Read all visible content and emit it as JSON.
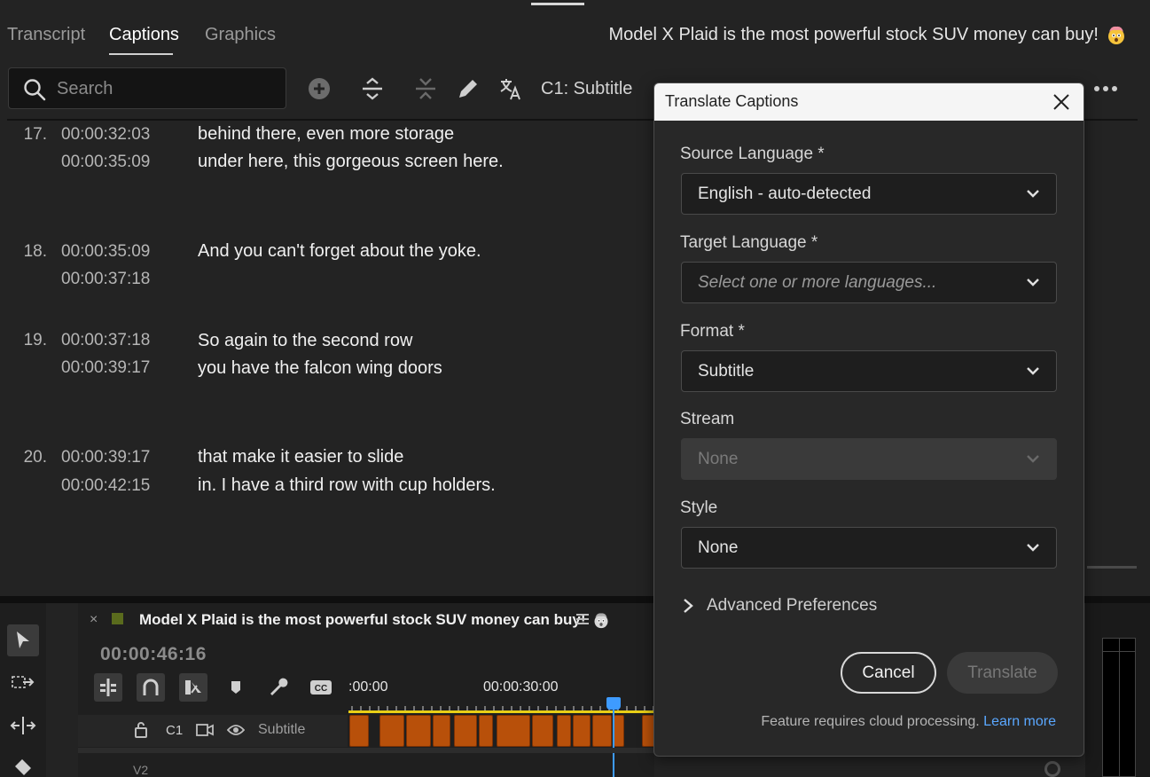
{
  "tabs": [
    {
      "label": "Transcript",
      "active": false
    },
    {
      "label": "Captions",
      "active": true
    },
    {
      "label": "Graphics",
      "active": false
    }
  ],
  "sequence_title": "Model X Plaid is the most powerful stock SUV money can buy!",
  "toolbar": {
    "search_placeholder": "Search",
    "track_label": "C1: Subtitle",
    "icons": [
      "search-icon",
      "add-caption-icon",
      "expand-icon",
      "collapse-icon",
      "pencil-icon",
      "translate-icon",
      "more-icon"
    ]
  },
  "captions": [
    {
      "num": "17.",
      "start": "00:00:32:03",
      "end": "00:00:35:09",
      "line1": "behind there, even more storage",
      "line2": "under here, this gorgeous screen here."
    },
    {
      "num": "18.",
      "start": "00:00:35:09",
      "end": "00:00:37:18",
      "line1": "And you can't forget about the yoke.",
      "line2": ""
    },
    {
      "num": "19.",
      "start": "00:00:37:18",
      "end": "00:00:39:17",
      "line1": "So again to the second row",
      "line2": "you have the falcon wing doors"
    },
    {
      "num": "20.",
      "start": "00:00:39:17",
      "end": "00:00:42:15",
      "line1": "that make it easier to slide",
      "line2": "in. I have a third row with cup holders."
    }
  ],
  "dialog": {
    "title": "Translate Captions",
    "source_label": "Source Language *",
    "source_value": "English - auto-detected",
    "target_label": "Target Language *",
    "target_placeholder": "Select one or more languages...",
    "format_label": "Format *",
    "format_value": "Subtitle",
    "stream_label": "Stream",
    "stream_value": "None",
    "style_label": "Style",
    "style_value": "None",
    "advanced_label": "Advanced Preferences",
    "cancel_label": "Cancel",
    "translate_label": "Translate",
    "footer_text": "Feature requires cloud processing.",
    "footer_link": "Learn more"
  },
  "timeline": {
    "close": "×",
    "title": "Model X Plaid is the most powerful stock SUV money can buy!",
    "timecode": "00:00:46:16",
    "ruler": [
      ":00:00",
      "00:00:30:00"
    ],
    "track": {
      "name": "C1",
      "label": "Subtitle"
    },
    "next_track": "V2"
  },
  "colors": {
    "background": "#232323",
    "accent_blue": "#3e9bff",
    "clip_orange": "#b8500a",
    "ruler_yellow": "#e8cf16",
    "link": "#5aa7ff"
  }
}
